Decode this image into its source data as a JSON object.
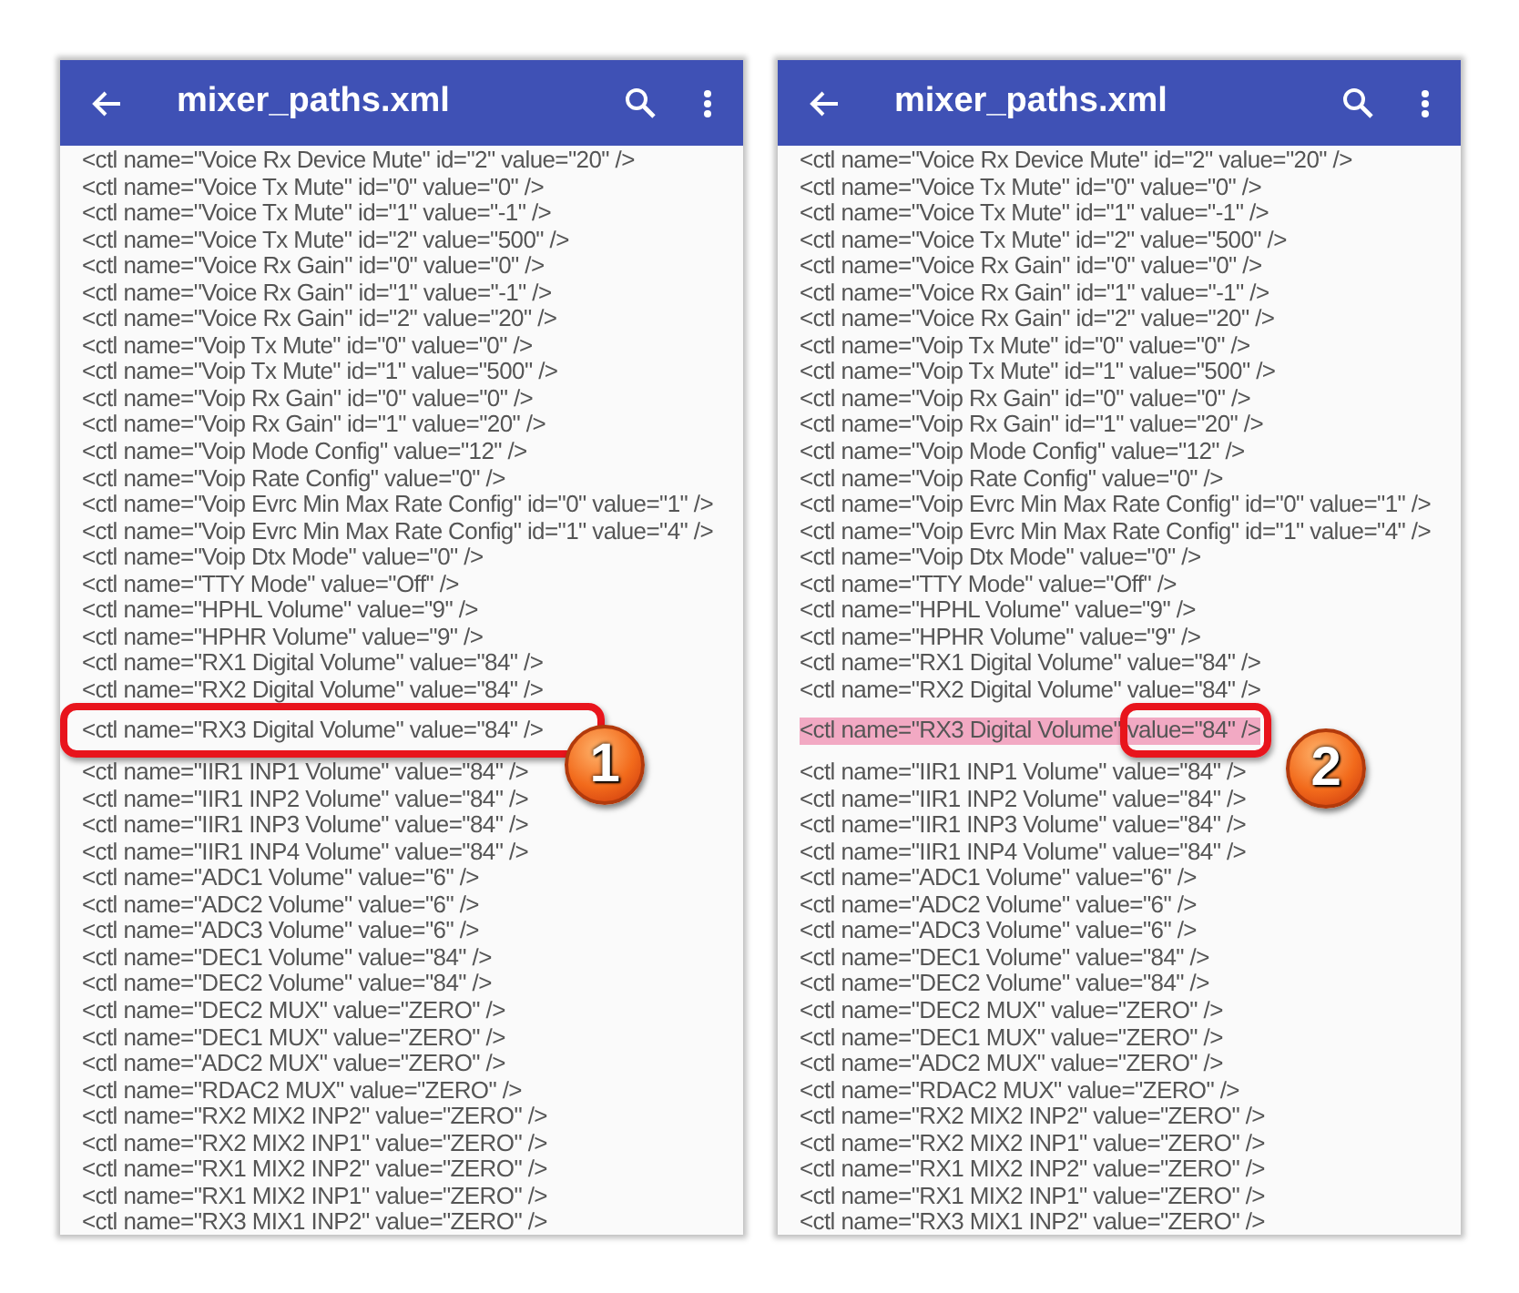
{
  "panels": [
    {
      "title": "mixer_paths.xml",
      "lines": [
        {
          "text": "<ctl name=\"Voice Rx Device Mute\" id=\"2\" value=\"20\" />",
          "selected": false
        },
        {
          "text": "<ctl name=\"Voice Tx Mute\" id=\"0\" value=\"0\" />",
          "selected": false
        },
        {
          "text": "<ctl name=\"Voice Tx Mute\" id=\"1\" value=\"-1\" />",
          "selected": false
        },
        {
          "text": "<ctl name=\"Voice Tx Mute\" id=\"2\" value=\"500\" />",
          "selected": false
        },
        {
          "text": "<ctl name=\"Voice Rx Gain\" id=\"0\" value=\"0\" />",
          "selected": false
        },
        {
          "text": "<ctl name=\"Voice Rx Gain\" id=\"1\" value=\"-1\" />",
          "selected": false
        },
        {
          "text": "<ctl name=\"Voice Rx Gain\" id=\"2\" value=\"20\" />",
          "selected": false
        },
        {
          "text": "<ctl name=\"Voip Tx Mute\" id=\"0\" value=\"0\" />",
          "selected": false
        },
        {
          "text": "<ctl name=\"Voip Tx Mute\" id=\"1\" value=\"500\" />",
          "selected": false
        },
        {
          "text": "<ctl name=\"Voip Rx Gain\" id=\"0\" value=\"0\" />",
          "selected": false
        },
        {
          "text": "<ctl name=\"Voip Rx Gain\" id=\"1\" value=\"20\" />",
          "selected": false
        },
        {
          "text": "<ctl name=\"Voip Mode Config\" value=\"12\" />",
          "selected": false
        },
        {
          "text": "<ctl name=\"Voip Rate Config\" value=\"0\" />",
          "selected": false
        },
        {
          "text": "<ctl name=\"Voip Evrc Min Max Rate Config\" id=\"0\" value=\"1\" />",
          "selected": false
        },
        {
          "text": "<ctl name=\"Voip Evrc Min Max Rate Config\" id=\"1\" value=\"4\" />",
          "selected": false
        },
        {
          "text": "<ctl name=\"Voip Dtx Mode\" value=\"0\" />",
          "selected": false
        },
        {
          "text": "<ctl name=\"TTY Mode\" value=\"Off\" />",
          "selected": false
        },
        {
          "text": "<ctl name=\"HPHL Volume\" value=\"9\" />",
          "selected": false
        },
        {
          "text": "<ctl name=\"HPHR Volume\" value=\"9\" />",
          "selected": false
        },
        {
          "text": "<ctl name=\"RX1 Digital Volume\" value=\"84\" />",
          "selected": false
        },
        {
          "text": "<ctl name=\"RX2 Digital Volume\" value=\"84\" />",
          "selected": false
        },
        {
          "text": "<ctl name=\"RX3 Digital Volume\" value=\"84\" />",
          "selected": false,
          "callout": {
            "label": "1",
            "kind": "line"
          }
        },
        {
          "text": "<ctl name=\"IIR1 INP1 Volume\" value=\"84\" />",
          "selected": false
        },
        {
          "text": "<ctl name=\"IIR1 INP2 Volume\" value=\"84\" />",
          "selected": false
        },
        {
          "text": "<ctl name=\"IIR1 INP3 Volume\" value=\"84\" />",
          "selected": false
        },
        {
          "text": "<ctl name=\"IIR1 INP4 Volume\" value=\"84\" />",
          "selected": false
        },
        {
          "text": "<ctl name=\"ADC1 Volume\" value=\"6\" />",
          "selected": false
        },
        {
          "text": "<ctl name=\"ADC2 Volume\" value=\"6\" />",
          "selected": false
        },
        {
          "text": "<ctl name=\"ADC3 Volume\" value=\"6\" />",
          "selected": false
        },
        {
          "text": "<ctl name=\"DEC1 Volume\" value=\"84\" />",
          "selected": false
        },
        {
          "text": "<ctl name=\"DEC2 Volume\" value=\"84\" />",
          "selected": false
        },
        {
          "text": "<ctl name=\"DEC2 MUX\" value=\"ZERO\" />",
          "selected": false
        },
        {
          "text": "<ctl name=\"DEC1 MUX\" value=\"ZERO\" />",
          "selected": false
        },
        {
          "text": "<ctl name=\"ADC2 MUX\" value=\"ZERO\" />",
          "selected": false
        },
        {
          "text": "<ctl name=\"RDAC2 MUX\" value=\"ZERO\" />",
          "selected": false
        },
        {
          "text": "<ctl name=\"RX2 MIX2 INP2\" value=\"ZERO\" />",
          "selected": false
        },
        {
          "text": "<ctl name=\"RX2 MIX2 INP1\" value=\"ZERO\" />",
          "selected": false
        },
        {
          "text": "<ctl name=\"RX1 MIX2 INP2\" value=\"ZERO\" />",
          "selected": false
        },
        {
          "text": "<ctl name=\"RX1 MIX2 INP1\" value=\"ZERO\" />",
          "selected": false
        },
        {
          "text": "<ctl name=\"RX3 MIX1 INP2\" value=\"ZERO\" />",
          "selected": false
        }
      ]
    },
    {
      "title": "mixer_paths.xml",
      "lines": [
        {
          "text": "<ctl name=\"Voice Rx Device Mute\" id=\"2\" value=\"20\" />",
          "selected": false
        },
        {
          "text": "<ctl name=\"Voice Tx Mute\" id=\"0\" value=\"0\" />",
          "selected": false
        },
        {
          "text": "<ctl name=\"Voice Tx Mute\" id=\"1\" value=\"-1\" />",
          "selected": false
        },
        {
          "text": "<ctl name=\"Voice Tx Mute\" id=\"2\" value=\"500\" />",
          "selected": false
        },
        {
          "text": "<ctl name=\"Voice Rx Gain\" id=\"0\" value=\"0\" />",
          "selected": false
        },
        {
          "text": "<ctl name=\"Voice Rx Gain\" id=\"1\" value=\"-1\" />",
          "selected": false
        },
        {
          "text": "<ctl name=\"Voice Rx Gain\" id=\"2\" value=\"20\" />",
          "selected": false
        },
        {
          "text": "<ctl name=\"Voip Tx Mute\" id=\"0\" value=\"0\" />",
          "selected": false
        },
        {
          "text": "<ctl name=\"Voip Tx Mute\" id=\"1\" value=\"500\" />",
          "selected": false
        },
        {
          "text": "<ctl name=\"Voip Rx Gain\" id=\"0\" value=\"0\" />",
          "selected": false
        },
        {
          "text": "<ctl name=\"Voip Rx Gain\" id=\"1\" value=\"20\" />",
          "selected": false
        },
        {
          "text": "<ctl name=\"Voip Mode Config\" value=\"12\" />",
          "selected": false
        },
        {
          "text": "<ctl name=\"Voip Rate Config\" value=\"0\" />",
          "selected": false
        },
        {
          "text": "<ctl name=\"Voip Evrc Min Max Rate Config\" id=\"0\" value=\"1\" />",
          "selected": false
        },
        {
          "text": "<ctl name=\"Voip Evrc Min Max Rate Config\" id=\"1\" value=\"4\" />",
          "selected": false
        },
        {
          "text": "<ctl name=\"Voip Dtx Mode\" value=\"0\" />",
          "selected": false
        },
        {
          "text": "<ctl name=\"TTY Mode\" value=\"Off\" />",
          "selected": false
        },
        {
          "text": "<ctl name=\"HPHL Volume\" value=\"9\" />",
          "selected": false
        },
        {
          "text": "<ctl name=\"HPHR Volume\" value=\"9\" />",
          "selected": false
        },
        {
          "text": "<ctl name=\"RX1 Digital Volume\" value=\"84\" />",
          "selected": false
        },
        {
          "text": "<ctl name=\"RX2 Digital Volume\" value=\"84\" />",
          "selected": false
        },
        {
          "text": "<ctl name=\"RX3 Digital Volume\" value=\"84\" />",
          "selected": true,
          "callout": {
            "label": "2",
            "kind": "value"
          }
        },
        {
          "text": "<ctl name=\"IIR1 INP1 Volume\" value=\"84\" />",
          "selected": false
        },
        {
          "text": "<ctl name=\"IIR1 INP2 Volume\" value=\"84\" />",
          "selected": false
        },
        {
          "text": "<ctl name=\"IIR1 INP3 Volume\" value=\"84\" />",
          "selected": false
        },
        {
          "text": "<ctl name=\"IIR1 INP4 Volume\" value=\"84\" />",
          "selected": false
        },
        {
          "text": "<ctl name=\"ADC1 Volume\" value=\"6\" />",
          "selected": false
        },
        {
          "text": "<ctl name=\"ADC2 Volume\" value=\"6\" />",
          "selected": false
        },
        {
          "text": "<ctl name=\"ADC3 Volume\" value=\"6\" />",
          "selected": false
        },
        {
          "text": "<ctl name=\"DEC1 Volume\" value=\"84\" />",
          "selected": false
        },
        {
          "text": "<ctl name=\"DEC2 Volume\" value=\"84\" />",
          "selected": false
        },
        {
          "text": "<ctl name=\"DEC2 MUX\" value=\"ZERO\" />",
          "selected": false
        },
        {
          "text": "<ctl name=\"DEC1 MUX\" value=\"ZERO\" />",
          "selected": false
        },
        {
          "text": "<ctl name=\"ADC2 MUX\" value=\"ZERO\" />",
          "selected": false
        },
        {
          "text": "<ctl name=\"RDAC2 MUX\" value=\"ZERO\" />",
          "selected": false
        },
        {
          "text": "<ctl name=\"RX2 MIX2 INP2\" value=\"ZERO\" />",
          "selected": false
        },
        {
          "text": "<ctl name=\"RX2 MIX2 INP1\" value=\"ZERO\" />",
          "selected": false
        },
        {
          "text": "<ctl name=\"RX1 MIX2 INP2\" value=\"ZERO\" />",
          "selected": false
        },
        {
          "text": "<ctl name=\"RX1 MIX2 INP1\" value=\"ZERO\" />",
          "selected": false
        },
        {
          "text": "<ctl name=\"RX3 MIX1 INP2\" value=\"ZERO\" />",
          "selected": false
        }
      ]
    }
  ]
}
